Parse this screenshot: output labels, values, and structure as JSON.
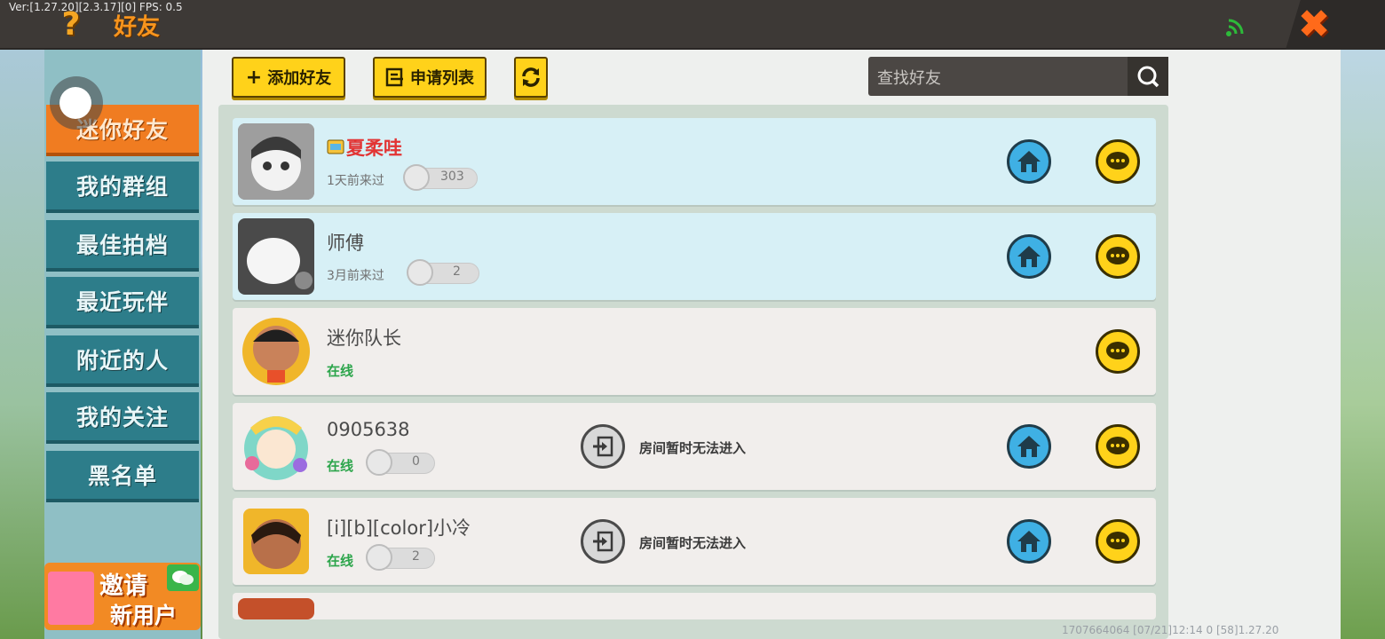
{
  "debug_text": "Ver:[1.27.20][2.3.17][0] FPS: 0.5",
  "header": {
    "help_icon": "?",
    "title": "好友",
    "close_icon": "✖"
  },
  "sidebar": {
    "items": [
      {
        "label": "迷你好友",
        "active": true
      },
      {
        "label": "我的群组",
        "active": false
      },
      {
        "label": "最佳拍档",
        "active": false
      },
      {
        "label": "最近玩伴",
        "active": false
      },
      {
        "label": "附近的人",
        "active": false
      },
      {
        "label": "我的关注",
        "active": false
      },
      {
        "label": "黑名单",
        "active": false
      }
    ],
    "invite": {
      "line1": "邀请",
      "line2": "新用户"
    }
  },
  "toolbar": {
    "add_friend": "添加好友",
    "request_list": "申请列表",
    "add_icon": "+",
    "search_placeholder": "查找好友"
  },
  "friends": [
    {
      "name": "夏柔哇",
      "status": "1天前来过",
      "count": "303",
      "style": "blue",
      "vip": true,
      "home": true,
      "chat": true
    },
    {
      "name": "师傅",
      "status": "3月前来过",
      "count": "2",
      "style": "blue",
      "vip": false,
      "home": true,
      "chat": true
    },
    {
      "name": "迷你队长",
      "status": "在线",
      "count": "",
      "style": "gray",
      "vip": false,
      "home": false,
      "chat": true
    },
    {
      "name": "0905638",
      "status": "在线",
      "count": "0",
      "style": "gray",
      "vip": false,
      "home": true,
      "chat": true,
      "room": "房间暂时无法进入"
    },
    {
      "name": "[i][b][color]小冷",
      "status": "在线",
      "count": "2",
      "style": "gray",
      "vip": false,
      "home": true,
      "chat": true,
      "room": "房间暂时无法进入"
    }
  ],
  "footer": "1707664064  [07/21]12:14 0  [58]1.27.20",
  "colors": {
    "accent_orange": "#f07c21",
    "sidebar_teal": "#2d7d8a",
    "button_yellow": "#ffd21a",
    "online_green": "#2ca54b",
    "home_blue": "#3fb0e4"
  }
}
